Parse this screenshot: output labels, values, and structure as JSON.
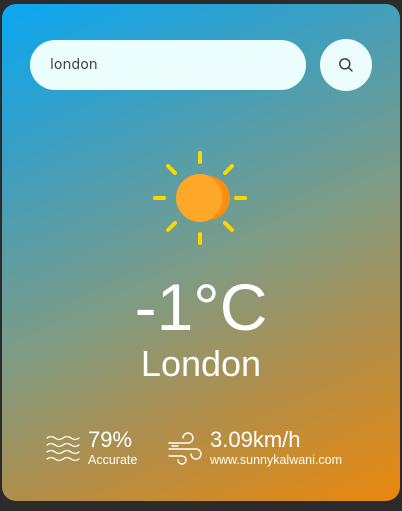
{
  "search": {
    "value": "london",
    "placeholder": ""
  },
  "search_button": {
    "icon": "search-icon"
  },
  "weather": {
    "icon": "sun-icon",
    "temperature": "-1°C",
    "city": "London"
  },
  "details": {
    "humidity": {
      "icon": "waves-icon",
      "value": "79%",
      "label": "Accurate"
    },
    "wind": {
      "icon": "wind-icon",
      "value": "3.09km/h",
      "label": "www.sunnykalwani.com"
    }
  },
  "colors": {
    "gradient_start": "#0aa7f2",
    "gradient_end": "#e9880c",
    "search_bg": "#ebfefd",
    "sun_body": "#ffa726",
    "sun_rays": "#ffd600",
    "text": "#ffffff"
  }
}
